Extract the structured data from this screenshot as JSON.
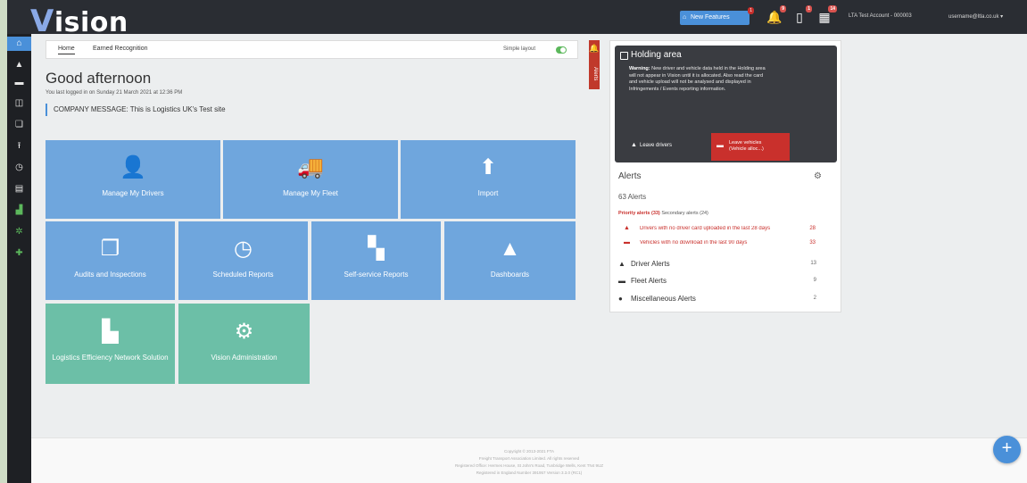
{
  "header": {
    "logo": "Vision",
    "new_features": "New Features",
    "new_features_badge": "1",
    "icons": [
      {
        "name": "bell-icon",
        "glyph": "🔔",
        "badge": "9"
      },
      {
        "name": "tablet-icon",
        "glyph": "▯",
        "badge": "1"
      },
      {
        "name": "calendar-icon",
        "glyph": "▦",
        "badge": "14"
      }
    ],
    "account": "LTA Test Account - 000003",
    "user": "username@ltla.co.uk ▾"
  },
  "sidebar": {
    "items": [
      {
        "name": "home-icon",
        "glyph": "⌂",
        "active": true
      },
      {
        "name": "driver-icon",
        "glyph": "▲"
      },
      {
        "name": "truck-icon",
        "glyph": "▬"
      },
      {
        "name": "inspection-icon",
        "glyph": "◫"
      },
      {
        "name": "documents-icon",
        "glyph": "❏"
      },
      {
        "name": "upload-icon",
        "glyph": "⭱"
      },
      {
        "name": "clock-icon",
        "glyph": "◷"
      },
      {
        "name": "dashboard-icon",
        "glyph": "▤"
      },
      {
        "name": "forklift-icon",
        "glyph": "▟",
        "green": true
      },
      {
        "name": "cogs-icon",
        "glyph": "✲",
        "green": true
      },
      {
        "name": "network-icon",
        "glyph": "✚",
        "green": true
      }
    ]
  },
  "subnav": {
    "home": "Home",
    "earned": "Earned Recognition",
    "simple_layout": "Simple layout"
  },
  "main": {
    "greeting": "Good afternoon",
    "last_login": "You last logged in on Sunday 21 March 2021 at 12:36 PM",
    "company_message": "COMPANY MESSAGE: This is Logistics UK's Test site"
  },
  "tiles": [
    {
      "name": "manage-my-drivers-tile",
      "label": "Manage My Drivers",
      "icon": "user-icon",
      "glyph": "👤",
      "color": "blue"
    },
    {
      "name": "manage-my-fleet-tile",
      "label": "Manage My Fleet",
      "icon": "truck-icon",
      "glyph": "🚚",
      "color": "blue"
    },
    {
      "name": "import-tile",
      "label": "Import",
      "icon": "upload-icon",
      "glyph": "⬆",
      "color": "blue"
    },
    {
      "name": "audits-inspections-tile",
      "label": "Audits and Inspections",
      "icon": "documents-icon",
      "glyph": "❐",
      "color": "blue"
    },
    {
      "name": "scheduled-reports-tile",
      "label": "Scheduled Reports",
      "icon": "clock-icon",
      "glyph": "◷",
      "color": "blue"
    },
    {
      "name": "self-service-reports-tile",
      "label": "Self-service Reports",
      "icon": "report-icon",
      "glyph": "▚",
      "color": "blue"
    },
    {
      "name": "dashboards-tile",
      "label": "Dashboards",
      "icon": "chart-icon",
      "glyph": "▲",
      "color": "blue"
    },
    {
      "name": "logistics-efficiency-tile",
      "label": "Logistics Efficiency Network Solution",
      "icon": "forklift-icon",
      "glyph": "▙",
      "color": "green"
    },
    {
      "name": "vision-administration-tile",
      "label": "Vision Administration",
      "icon": "cogs-icon",
      "glyph": "⚙",
      "color": "green"
    }
  ],
  "alerts_tab": {
    "label": "Alerts",
    "glyph": "🔔"
  },
  "holding_area": {
    "title": "Holding area",
    "warning_bold": "Warning:",
    "warning": "New driver and vehicle data held in the Holding area will not appear in Vision until it is allocated. Also read the card and vehicle upload will not be analysed and displayed in Infringements / Events reporting information.",
    "leave_drivers": "Leave drivers",
    "leave_vehicles_line1": "Leave vehicles",
    "leave_vehicles_line2": "(Vehicle alloc...)"
  },
  "alerts": {
    "title": "Alerts",
    "count": "63 Alerts",
    "priority": "Priority alerts (33)",
    "secondary": "Secondary alerts (24)",
    "rows": [
      {
        "icon": "driver-icon",
        "glyph": "▲",
        "text": "Drivers with no driver card uploaded in the last 28 days",
        "count": "28"
      },
      {
        "icon": "truck-icon",
        "glyph": "▬",
        "text": "Vehicles with no download in the last 90 days",
        "count": "33"
      }
    ],
    "categories": [
      {
        "name": "driver-alerts",
        "icon": "driver-icon",
        "glyph": "▲",
        "label": "Driver Alerts",
        "count": "13"
      },
      {
        "name": "fleet-alerts",
        "icon": "truck-icon",
        "glyph": "▬",
        "label": "Fleet Alerts",
        "count": "9"
      },
      {
        "name": "misc-alerts",
        "icon": "circle-icon",
        "glyph": "●",
        "label": "Miscellaneous Alerts",
        "count": "2"
      }
    ]
  },
  "footer": {
    "lines": [
      "Copyright © 2013-2021 FTA",
      "Freight Transport Association Limited. All rights reserved",
      "Registered Office: Hermes House, St John's Road, Tunbridge Wells, Kent TN4 9UZ",
      "Registered in England Number 391957 Version 3.3.0 (RC1)"
    ]
  },
  "fab": "+",
  "colors": {
    "accent": "#4a90d9",
    "tile_blue": "#6fa6dd",
    "tile_green": "#6cbfa7",
    "danger": "#c9302c",
    "header": "#2a2d33"
  }
}
